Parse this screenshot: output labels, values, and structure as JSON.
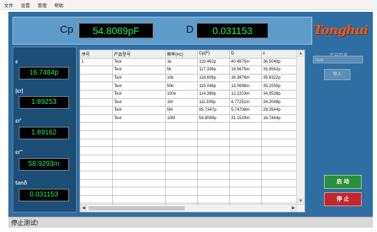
{
  "menu": [
    "文件",
    "设置",
    "管理",
    "帮助"
  ],
  "measurement": {
    "primary_label": "Cp",
    "primary_value": "54.8089pF",
    "secondary_label": "D",
    "secondary_value": "0.031153"
  },
  "brand": {
    "logo_text": "Tonghui"
  },
  "params": [
    {
      "label": "ε",
      "value": "16.7484p"
    },
    {
      "label": "|εr|",
      "value": "1.89253"
    },
    {
      "label": "εr'",
      "value": "1.89162"
    },
    {
      "label": "εr''",
      "value": "58.9293m"
    },
    {
      "label": "tanδ",
      "value": "0.031153"
    }
  ],
  "table": {
    "headers": [
      "序号",
      "产品型号",
      "频率(Hz)",
      "Cp(F)",
      "D",
      "ε"
    ],
    "rows": [
      [
        "1",
        "Test",
        "1k",
        "119.462p",
        "40.4975m",
        "36.5049p"
      ],
      [
        "",
        "Test",
        "5k",
        "117.339p",
        "19.5675m",
        "35.8562p"
      ],
      [
        "",
        "Test",
        "10k",
        "116.606p",
        "16.3876m",
        "35.6322p"
      ],
      [
        "",
        "Test",
        "50k",
        "115.046p",
        "13.0698m",
        "35.1555p"
      ],
      [
        "",
        "Test",
        "100k",
        "114.386p",
        "12.2203m",
        "34.9538p"
      ],
      [
        "",
        "Test",
        "1M",
        "111.935p",
        "4.77251m",
        "34.2048p"
      ],
      [
        "",
        "Test",
        "5M",
        "95.7347p",
        "5.74708m",
        "29.2544p"
      ],
      [
        "",
        "Test",
        "10M",
        "54.8089p",
        "31.1529m",
        "16.7484p"
      ]
    ]
  },
  "side": {
    "model_label": "产品型号",
    "model_value": "Test",
    "import_label": "导入",
    "start_label": "启 动",
    "stop_label": "停 止"
  },
  "status": {
    "text": "停止测试!"
  },
  "colors": {
    "background": "#2f6ea3",
    "display": "#000000",
    "display_text": "#1ff06a",
    "start": "#2c8e3a",
    "stop": "#c0282d",
    "logo": "#e35b1f"
  }
}
